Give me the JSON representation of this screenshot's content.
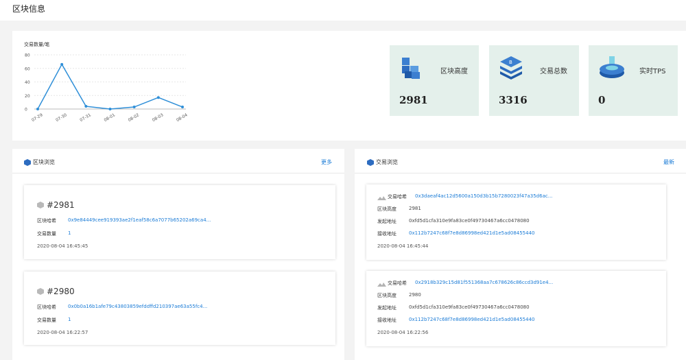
{
  "page": {
    "title": "区块信息"
  },
  "chart_data": {
    "type": "line",
    "title": "交易数量/笔",
    "categories": [
      "07-29",
      "07-30",
      "07-31",
      "08-01",
      "08-02",
      "08-03",
      "08-04"
    ],
    "values": [
      0,
      66,
      4,
      0,
      3,
      17,
      3
    ],
    "ylim": [
      0,
      80
    ],
    "yticks": [
      0,
      20,
      40,
      60,
      80
    ],
    "series_color": "#2f8fd8",
    "grid": true
  },
  "stats": [
    {
      "label": "区块高度",
      "value": "2981",
      "icon": "cubes-icon"
    },
    {
      "label": "交易总数",
      "value": "3316",
      "icon": "stack-icon"
    },
    {
      "label": "实时TPS",
      "value": "0",
      "icon": "disk-icon"
    }
  ],
  "blocks_panel": {
    "title": "区块浏览",
    "more": "更多",
    "items": [
      {
        "number": "#2981",
        "hash_label": "区块哈希",
        "hash": "0x9e84449cee919393ae2f1eaf58c6a7077b65202a69ca4...",
        "count_label": "交易数量",
        "count": "1",
        "time": "2020-08-04 16:45:45"
      },
      {
        "number": "#2980",
        "hash_label": "区块哈希",
        "hash": "0x0b0a16b1afe79c43803859efddffd210397ae63a55fc4...",
        "count_label": "交易数量",
        "count": "1",
        "time": "2020-08-04 16:22:57"
      }
    ]
  },
  "tx_panel": {
    "title": "交易浏览",
    "more": "最新",
    "items": [
      {
        "hash_label": "交易哈希",
        "hash": "0x3daeaf4ac12d5600a150d3b15b7280023f47a35d6ac...",
        "height_label": "区块高度",
        "height": "2981",
        "from_label": "发起地址",
        "from": "0xfd5d1cfa310e9fa83ce0f49730467a6cc0478080",
        "to_label": "接收地址",
        "to": "0x112b7247c68f7e8d86998ed421d1e5ad08455440",
        "time": "2020-08-04 16:45:44"
      },
      {
        "hash_label": "交易哈希",
        "hash": "0x2918b329c15d81f551368aa7c678626c86ccd3d91e4...",
        "height_label": "区块高度",
        "height": "2980",
        "from_label": "发起地址",
        "from": "0xfd5d1cfa310e9fa83ce0f49730467a6cc0478080",
        "to_label": "接收地址",
        "to": "0x112b7247c68f7e8d86998ed421d1e5ad08455440",
        "time": "2020-08-04 16:22:56"
      }
    ]
  }
}
